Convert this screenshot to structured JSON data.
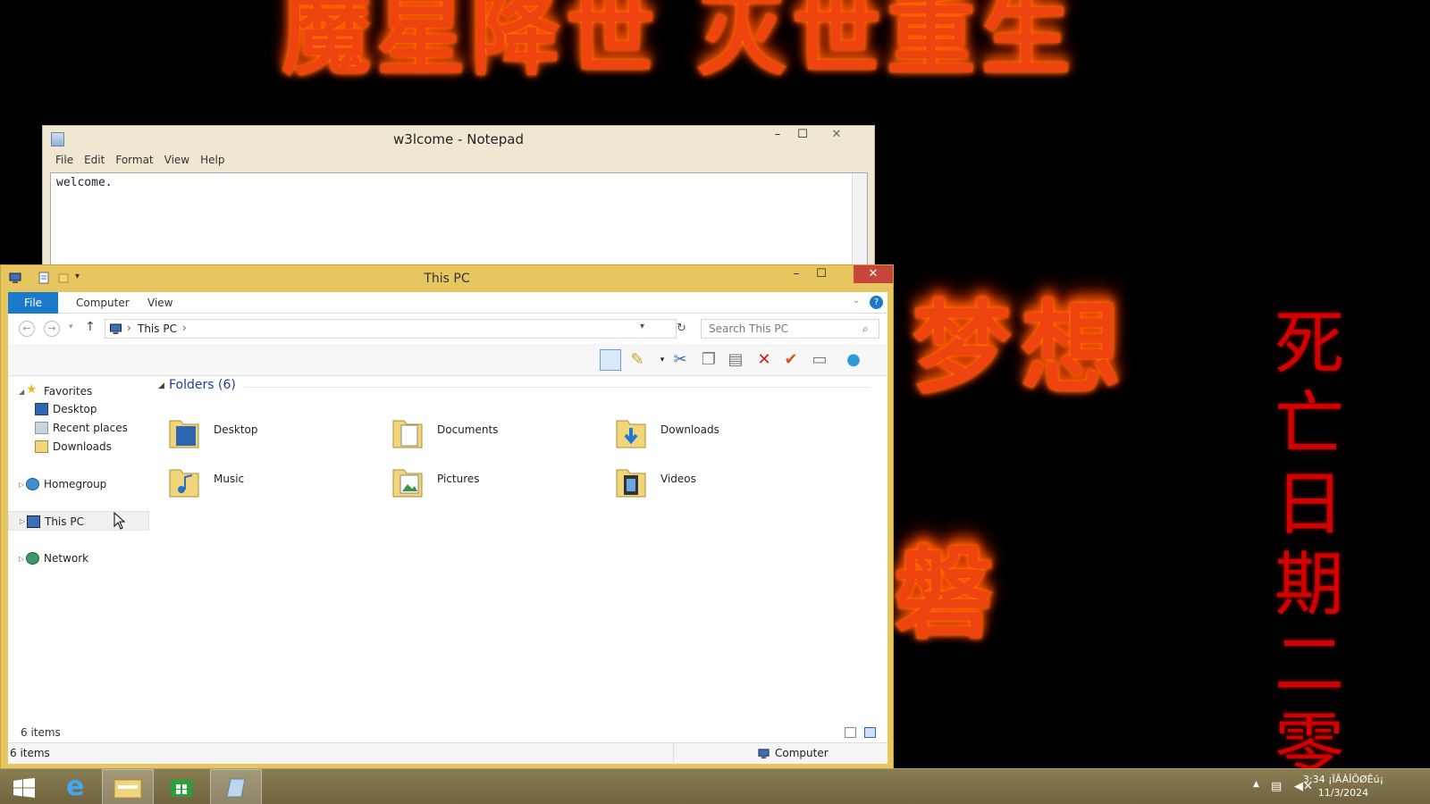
{
  "desktop": {
    "fire_top": "魔星降世 灭世重生",
    "fire_dream": "梦想",
    "fire_mid": "磐",
    "red_vertical": [
      "死",
      "亡",
      "日",
      "期",
      "二",
      "零"
    ]
  },
  "notepad": {
    "title": "w3lcome - Notepad",
    "menu": [
      "File",
      "Edit",
      "Format",
      "View",
      "Help"
    ],
    "content": "welcome.",
    "minimize": "–",
    "maximize": "☐",
    "close": "✕"
  },
  "explorer": {
    "title": "This PC",
    "minimize": "–",
    "maximize": "☐",
    "close": "✕",
    "tabs": {
      "file": "File",
      "computer": "Computer",
      "view": "View"
    },
    "address": {
      "location": "This PC",
      "sep": "›"
    },
    "search": {
      "placeholder": "Search This PC"
    },
    "nav": {
      "favorites": "Favorites",
      "desktop": "Desktop",
      "recent": "Recent places",
      "downloads": "Downloads",
      "homegroup": "Homegroup",
      "thispc": "This PC",
      "network": "Network"
    },
    "folders_header": "Folders (6)",
    "folders": [
      {
        "label": "Desktop",
        "icon": "desktop-folder-icon"
      },
      {
        "label": "Documents",
        "icon": "documents-folder-icon"
      },
      {
        "label": "Downloads",
        "icon": "downloads-folder-icon"
      },
      {
        "label": "Music",
        "icon": "music-folder-icon"
      },
      {
        "label": "Pictures",
        "icon": "pictures-folder-icon"
      },
      {
        "label": "Videos",
        "icon": "videos-folder-icon"
      }
    ],
    "status_count": "6 items",
    "status_bottom_count": "6 items",
    "status_computer": "Computer"
  },
  "taskbar": {
    "time": "3:34 ¡ÏÂÀÎÕØÊú¡",
    "date": "11/3/2024"
  },
  "colors": {
    "explorer_frame": "#e8c65f",
    "file_tab": "#1979ca",
    "close_button": "#c7463b",
    "fire": "#f04410",
    "taskbar": "#7a6e48"
  }
}
